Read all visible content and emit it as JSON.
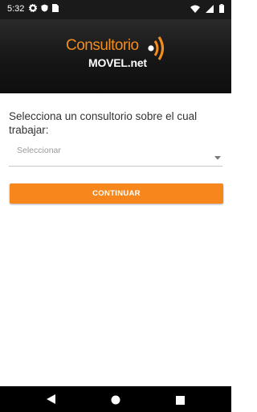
{
  "statusbar": {
    "time": "5:32"
  },
  "logo": {
    "line1": "Consultorio",
    "line2": "MOVEL.net"
  },
  "form": {
    "prompt": "Selecciona un consultorio sobre el cual trabajar:",
    "select_value": "Seleccionar",
    "continue_label": "CONTINUAR"
  },
  "colors": {
    "accent": "#f7871c",
    "header_bg": "#1a1a1a"
  },
  "icons": [
    "gear-icon",
    "shield-icon",
    "sim-card-icon",
    "wifi-icon",
    "signal-icon",
    "battery-icon",
    "back-icon",
    "home-icon",
    "recents-icon",
    "dropdown-caret-icon"
  ]
}
